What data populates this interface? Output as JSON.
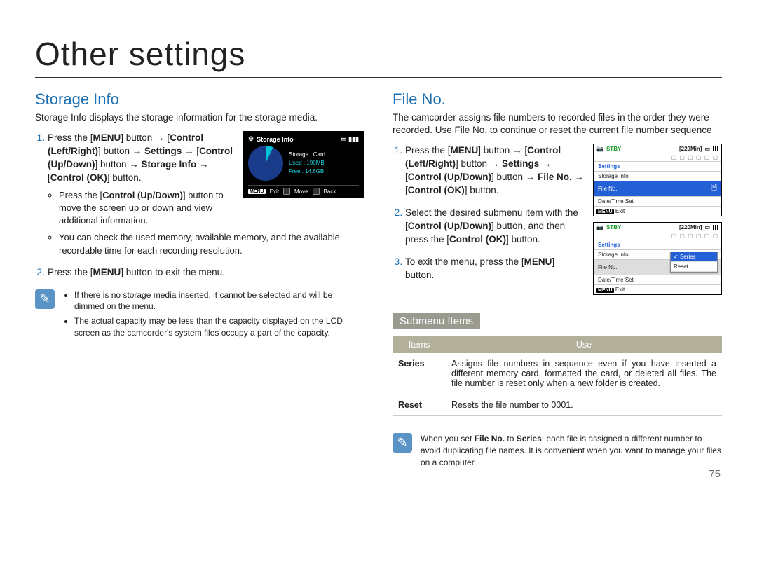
{
  "page_title": "Other settings",
  "page_number": "75",
  "storage": {
    "heading": "Storage Info",
    "intro": "Storage Info displays the storage information for the storage media.",
    "step1_prefix": "Press the [",
    "menu_bold": "MENU",
    "step1_mid1": "] button → [",
    "ctrl_lr_bold": "Control (Left/Right)",
    "step1_mid2": "] button → ",
    "settings_bold": "Settings",
    "arrow2": " → [",
    "ctrl_ud_bold": "Control (Up/Down)",
    "step1_mid3": "] button → ",
    "storage_info_bold": "Storage Info",
    "arrow3": " → [",
    "ctrl_ok_bold": "Control (OK)",
    "step1_end": "] button.",
    "sub_a_prefix": "Press the [",
    "sub_a_bold": "Control (Up/Down)",
    "sub_a_suffix": "] button to move the screen up or down and view additional information.",
    "sub_b": "You can check the used memory, available memory, and the available recordable time for each recording resolution.",
    "step2_prefix": "Press the [",
    "step2_bold": "MENU",
    "step2_suffix": "] button to exit the menu.",
    "panel": {
      "title": "Storage Info",
      "storage_label": "Storage",
      "storage_value": ": Card",
      "used_label": "Used",
      "used_value": ": 190MB",
      "free_label": "Free",
      "free_value": ": 14.6GB",
      "foot_menu": "MENU",
      "foot_exit": "Exit",
      "foot_move": "Move",
      "foot_back": "Back"
    },
    "note1": "If there is no storage media inserted, it cannot be selected and will be dimmed on the menu.",
    "note2": "The actual capacity may be less than the capacity displayed on the LCD screen as the camcorder's system files occupy a part of the capacity."
  },
  "fileno": {
    "heading": "File No.",
    "intro": "The camcorder assigns file numbers to recorded files in the order they were recorded. Use File No. to continue or reset the current file number sequence",
    "step1_prefix": "Press the [",
    "step1_mid1": "] button → [",
    "step1_mid2": "] button → ",
    "step1_arrow2": " → [",
    "step1_mid3": "] button → ",
    "fileno_bold": "File No.",
    "step1_arrow3": " → [",
    "step1_end": "] button.",
    "step2_prefix": "Select the desired submenu item with the [",
    "step2_bold": "Control (Up/Down)",
    "step2_mid": "] button, and then press the [",
    "step2_bold2": "Control (OK)",
    "step2_suffix": "] button.",
    "step3_prefix": "To exit the menu, press the [",
    "step3_bold": "MENU",
    "step3_suffix": "] button.",
    "mini": {
      "stby": "STBY",
      "time": "[220Min]",
      "settings": "Settings",
      "storage_info": "Storage Info",
      "file_no": "File No.",
      "date_time": "Date/Time Set",
      "exit": "Exit",
      "menu_tag": "MENU",
      "dd_series": "Series",
      "dd_reset": "Reset"
    },
    "submenu_title": "Submenu Items",
    "table": {
      "h_items": "Items",
      "h_use": "Use",
      "series_label": "Series",
      "series_desc": "Assigns file numbers in sequence even if you have inserted a different memory card, formatted the card, or deleted all files. The file number is reset only when a new folder is created.",
      "reset_label": "Reset",
      "reset_desc": "Resets the file number to 0001."
    },
    "note_prefix": "When you set ",
    "note_fileno_bold": "File No.",
    "note_mid": " to ",
    "note_series_bold": "Series",
    "note_suffix": ", each file is assigned a different number to avoid duplicating file names. It is convenient when you want to manage your files on a computer."
  }
}
